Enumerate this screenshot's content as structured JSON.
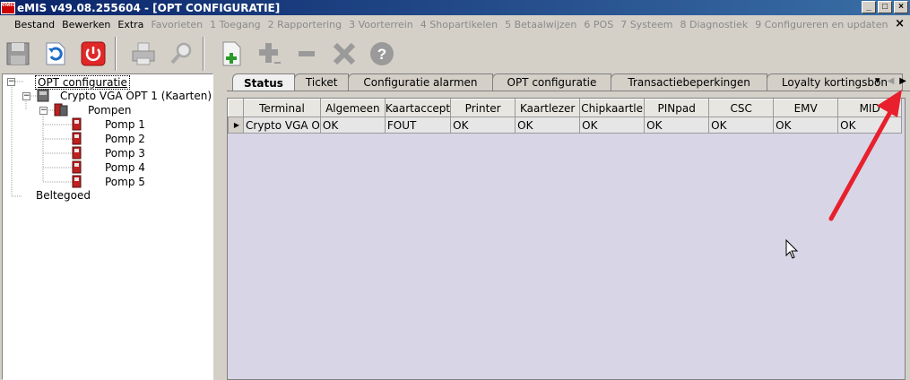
{
  "window": {
    "title": "eMIS v49.08.255604 - [OPT CONFIGURATIE]",
    "controls": [
      "_",
      "□",
      "×"
    ]
  },
  "menu": {
    "items": [
      {
        "label": "Bestand",
        "enabled": true
      },
      {
        "label": "Bewerken",
        "enabled": true
      },
      {
        "label": "Extra",
        "enabled": true
      },
      {
        "label": "Favorieten",
        "enabled": false
      },
      {
        "label": "1 Toegang",
        "enabled": false
      },
      {
        "label": "2 Rapportering",
        "enabled": false
      },
      {
        "label": "3 Voorterrein",
        "enabled": false
      },
      {
        "label": "4 Shopartikelen",
        "enabled": false
      },
      {
        "label": "5 Betaalwijzen",
        "enabled": false
      },
      {
        "label": "6 POS",
        "enabled": false
      },
      {
        "label": "7 Systeem",
        "enabled": false
      },
      {
        "label": "8 Diagnostiek",
        "enabled": false
      },
      {
        "label": "9 Configureren en updaten",
        "enabled": false
      }
    ],
    "close": "×"
  },
  "toolbar": {
    "buttons": [
      "save-icon",
      "undo-icon",
      "power-icon",
      "print-icon",
      "search-icon",
      "new-document-icon",
      "add-icon",
      "remove-icon",
      "delete-icon",
      "help-icon"
    ]
  },
  "tree": {
    "root": "OPT configuratie",
    "terminal": "Crypto VGA OPT 1 (Kaarten)",
    "pumps_group": "Pompen",
    "pumps": [
      "Pomp 1",
      "Pomp 2",
      "Pomp 3",
      "Pomp 4",
      "Pomp 5"
    ],
    "credit": "Beltegoed"
  },
  "tabs": [
    {
      "label": "Status",
      "active": true
    },
    {
      "label": "Ticket",
      "active": false
    },
    {
      "label": "Configuratie alarmen",
      "active": false
    },
    {
      "label": "OPT configuratie",
      "active": false
    },
    {
      "label": "Transactiebeperkingen",
      "active": false
    },
    {
      "label": "Loyalty kortingsbon",
      "active": false
    }
  ],
  "tabnav": {
    "dropdown": "▼",
    "prev": "◀",
    "next": "▶"
  },
  "grid": {
    "columns": [
      "Terminal",
      "Algemeen",
      "Kaartaccept",
      "Printer",
      "Kaartlezer",
      "Chipkaartle",
      "PINpad",
      "CSC",
      "EMV",
      "MID"
    ],
    "rows": [
      [
        "Crypto VGA O",
        "OK",
        "FOUT",
        "OK",
        "OK",
        "OK",
        "OK",
        "OK",
        "OK",
        "OK"
      ]
    ]
  },
  "colors": {
    "title_bar": "#0a246a",
    "arrow_annotation": "#e8202e",
    "grid_background": "#d8d5e6"
  }
}
